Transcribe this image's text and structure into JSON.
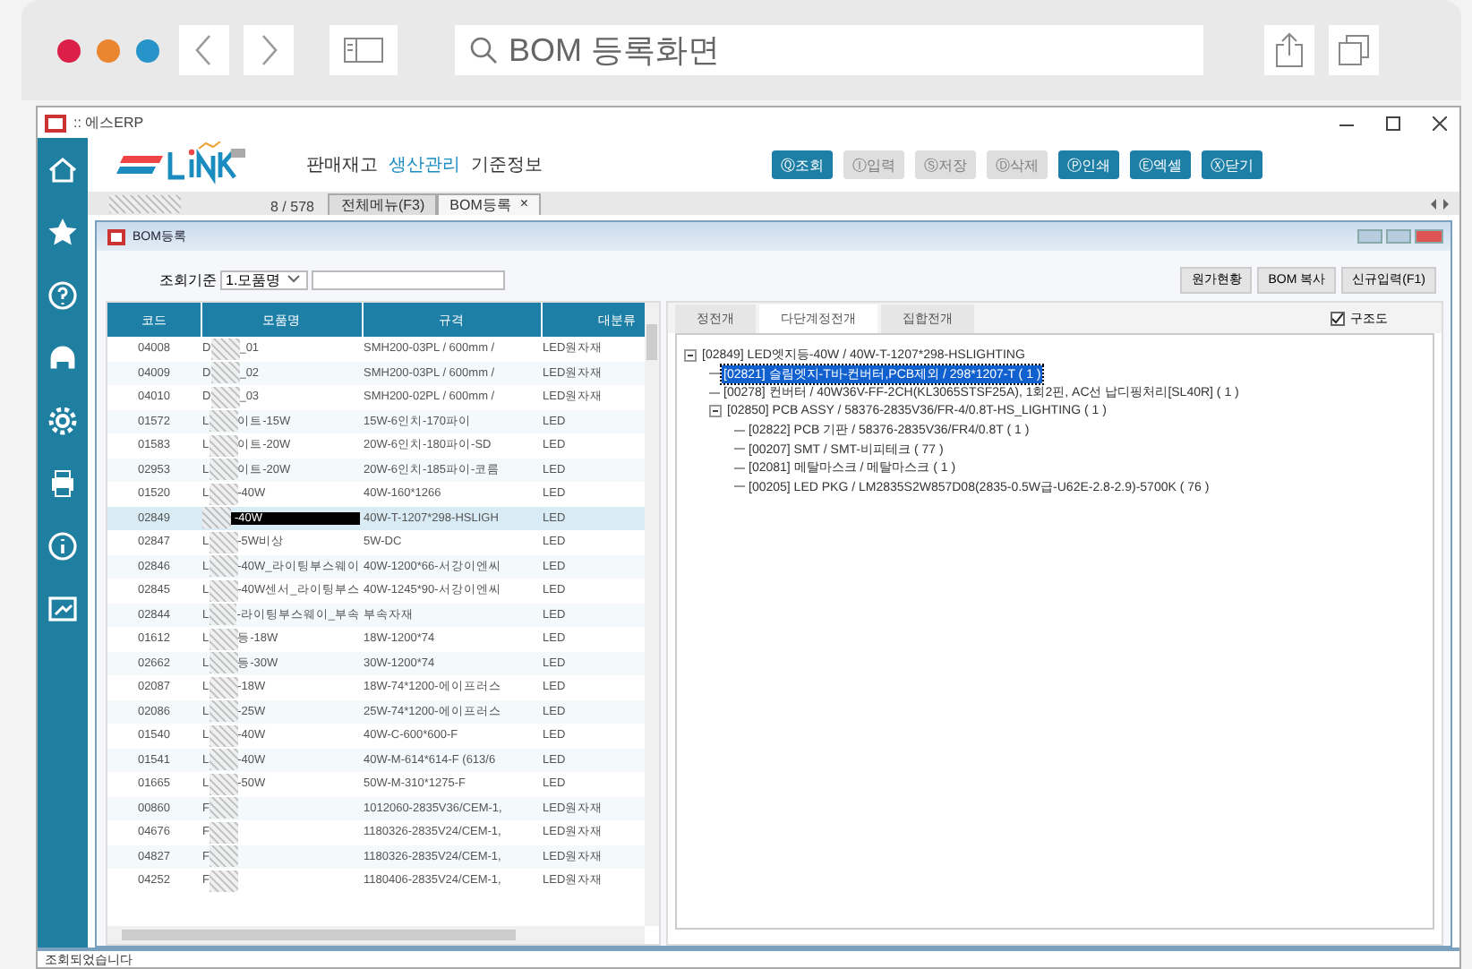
{
  "browser": {
    "address": "BOM 등록화면"
  },
  "window": {
    "title": ":: 에스ERP"
  },
  "menu": [
    {
      "label": "판매재고",
      "selected": false
    },
    {
      "label": "생산관리",
      "selected": true
    },
    {
      "label": "기준정보",
      "selected": false
    }
  ],
  "toolbar": [
    {
      "label": "Ⓠ조회",
      "disabled": false
    },
    {
      "label": "Ⓘ입력",
      "disabled": true
    },
    {
      "label": "Ⓢ저장",
      "disabled": true
    },
    {
      "label": "Ⓓ삭제",
      "disabled": true
    },
    {
      "label": "Ⓟ인쇄",
      "disabled": false
    },
    {
      "label": "Ⓔ엑셀",
      "disabled": false
    },
    {
      "label": "Ⓧ닫기",
      "disabled": false
    }
  ],
  "page_counter": "8 / 578",
  "doc_tabs": [
    {
      "label": "전체메뉴(F3)",
      "selected": false
    },
    {
      "label": "BOM등록",
      "selected": true
    }
  ],
  "close_glyph": "×",
  "inner_window": {
    "title": "BOM등록"
  },
  "filter": {
    "label": "조회기준",
    "value": "1.모품명"
  },
  "actions": [
    "원가현황",
    "BOM 복사",
    "신규입력(F1)"
  ],
  "table": {
    "columns": [
      "코드",
      "모품명",
      "규격",
      "대분류"
    ],
    "rows": [
      {
        "code": "04008",
        "name": {
          "start": "D",
          "end": "_01"
        },
        "spec": "SMH200-03PL / 600mm /",
        "category": "LED원자재",
        "selected": false
      },
      {
        "code": "04009",
        "name": {
          "start": "D",
          "end": "_02"
        },
        "spec": "SMH200-03PL / 600mm /",
        "category": "LED원자재",
        "selected": false
      },
      {
        "code": "04010",
        "name": {
          "start": "D",
          "end": "_03"
        },
        "spec": "SMH200-02PL / 600mm /",
        "category": "LED원자재",
        "selected": false
      },
      {
        "code": "01572",
        "name": {
          "start": "L",
          "end": "이트-15W"
        },
        "spec": "15W-6인치-170파이",
        "category": "LED",
        "selected": false
      },
      {
        "code": "01583",
        "name": {
          "start": "L",
          "end": "이트-20W"
        },
        "spec": "20W-6인치-180파이-SD",
        "category": "LED",
        "selected": false
      },
      {
        "code": "02953",
        "name": {
          "start": "L",
          "end": "이트-20W"
        },
        "spec": "20W-6인치-185파이-코름",
        "category": "LED",
        "selected": false
      },
      {
        "code": "01520",
        "name": {
          "start": "L",
          "end": "-40W"
        },
        "spec": "40W-160*1266",
        "category": "LED",
        "selected": false
      },
      {
        "code": "02849",
        "name": {
          "end": "-40W"
        },
        "spec": "40W-T-1207*298-HSLIGH",
        "category": "LED",
        "selected": true
      },
      {
        "code": "02847",
        "name": {
          "start": "L",
          "end": "-5W비상"
        },
        "spec": "5W-DC",
        "category": "LED",
        "selected": false
      },
      {
        "code": "02846",
        "name": {
          "start": "L",
          "end": "-40W_라이팅부스웨이"
        },
        "spec": "40W-1200*66-서강이엔씨",
        "category": "LED",
        "selected": false
      },
      {
        "code": "02845",
        "name": {
          "start": "L",
          "end": "-40W센서_라이팅부스"
        },
        "spec": "40W-1245*90-서강이엔씨",
        "category": "LED",
        "selected": false
      },
      {
        "code": "02844",
        "name": {
          "start": "L",
          "end": "-라이팅부스웨이_부속"
        },
        "spec": "부속자재",
        "category": "LED",
        "selected": false
      },
      {
        "code": "01612",
        "name": {
          "start": "L",
          "end": "등-18W"
        },
        "spec": "18W-1200*74",
        "category": "LED",
        "selected": false
      },
      {
        "code": "02662",
        "name": {
          "start": "L",
          "end": "등-30W"
        },
        "spec": "30W-1200*74",
        "category": "LED",
        "selected": false
      },
      {
        "code": "02087",
        "name": {
          "start": "L",
          "end": "-18W"
        },
        "spec": "18W-74*1200-에이프러스",
        "category": "LED",
        "selected": false
      },
      {
        "code": "02086",
        "name": {
          "start": "L",
          "end": "-25W"
        },
        "spec": "25W-74*1200-에이프러스",
        "category": "LED",
        "selected": false
      },
      {
        "code": "01540",
        "name": {
          "start": "L",
          "end": "-40W"
        },
        "spec": "40W-C-600*600-F",
        "category": "LED",
        "selected": false
      },
      {
        "code": "01541",
        "name": {
          "start": "L",
          "end": "-40W"
        },
        "spec": "40W-M-614*614-F (613/6",
        "category": "LED",
        "selected": false
      },
      {
        "code": "01665",
        "name": {
          "start": "L",
          "end": "-50W"
        },
        "spec": "50W-M-310*1275-F",
        "category": "LED",
        "selected": false
      },
      {
        "code": "00860",
        "name": {
          "start": "F"
        },
        "spec": "1012060-2835V36/CEM-1,",
        "category": "LED원자재",
        "selected": false
      },
      {
        "code": "04676",
        "name": {
          "start": "F"
        },
        "spec": "1180326-2835V24/CEM-1,",
        "category": "LED원자재",
        "selected": false
      },
      {
        "code": "04827",
        "name": {
          "start": "F"
        },
        "spec": "1180326-2835V24/CEM-1,",
        "category": "LED원자재",
        "selected": false
      },
      {
        "code": "04252",
        "name": {
          "start": "F"
        },
        "spec": "1180406-2835V24/CEM-1,",
        "category": "LED원자재",
        "selected": false
      }
    ]
  },
  "view_tabs": [
    {
      "label": "정전개",
      "selected": false
    },
    {
      "label": "다단계정전개",
      "selected": true
    },
    {
      "label": "집합전개",
      "selected": false
    }
  ],
  "structure_toggle": {
    "label": "구조도",
    "checked": true
  },
  "tree": [
    {
      "label": "[02849] LED엣지등-40W / 40W-T-1207*298-HSLIGHTING",
      "selected": false,
      "expanded": true,
      "children": [
        {
          "label": "[02821] 슬림엣지-T바-컨버터,PCB제외 / 298*1207-T ( 1 )",
          "selected": true
        },
        {
          "label": "[00278] 컨버터 / 40W36V-FF-2CH(KL3065STSF25A), 1회2핀, AC선 납디핑처리[SL40R] ( 1 )",
          "selected": false
        },
        {
          "label": "[02850] PCB ASSY / 58376-2835V36/FR-4/0.8T-HS_LIGHTING ( 1 )",
          "selected": false,
          "expanded": true,
          "children": [
            {
              "label": "[02822] PCB 기판 / 58376-2835V36/FR4/0.8T ( 1 )",
              "selected": false
            },
            {
              "label": "[00207] SMT / SMT-비피테크 ( 77 )",
              "selected": false
            },
            {
              "label": "[02081] 메탈마스크 / 메탈마스크 ( 1 )",
              "selected": false
            },
            {
              "label": "[00205] LED PKG / LM2835S2W857D08(2835-0.5W급-U62E-2.8-2.9)-5700K ( 76 )",
              "selected": false
            }
          ]
        }
      ]
    }
  ],
  "status_bar": "조회되었습니다"
}
